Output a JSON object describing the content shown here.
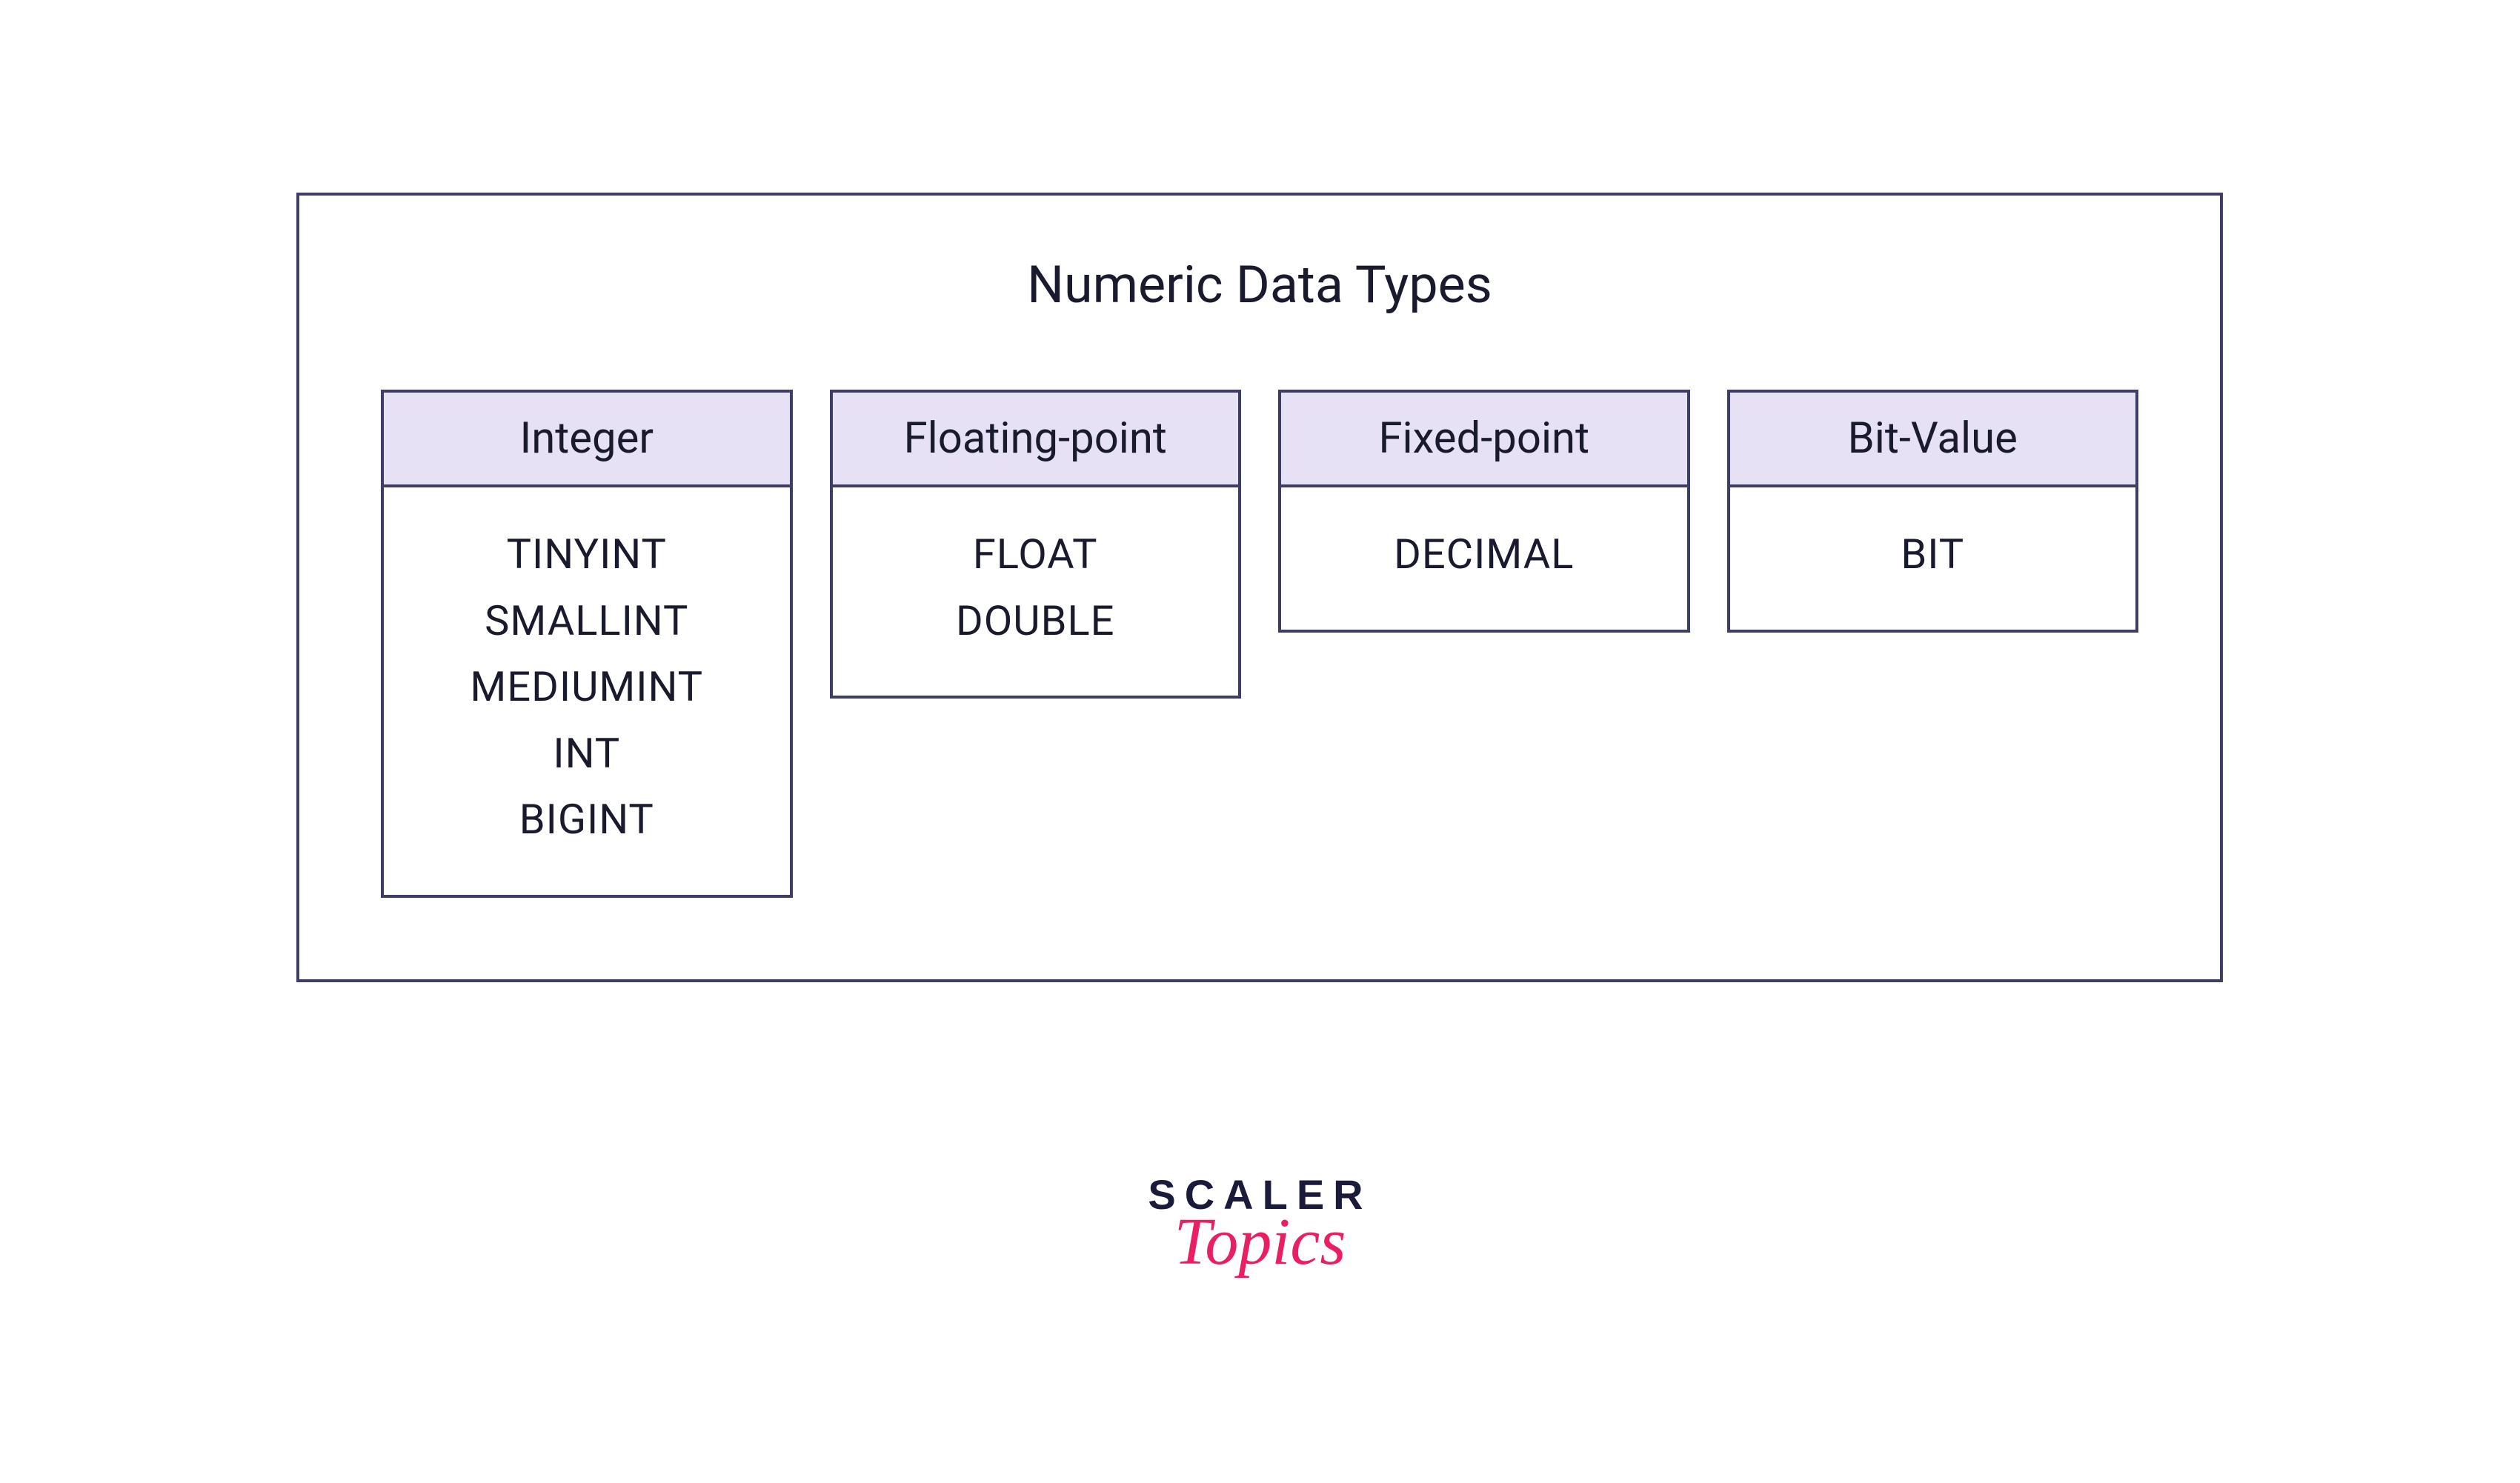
{
  "diagram": {
    "title": "Numeric Data Types",
    "categories": [
      {
        "header": "Integer",
        "items": [
          "TINYINT",
          "SMALLINT",
          "MEDIUMINT",
          "INT",
          "BIGINT"
        ]
      },
      {
        "header": "Floating-point",
        "items": [
          "FLOAT",
          "DOUBLE"
        ]
      },
      {
        "header": "Fixed-point",
        "items": [
          "DECIMAL"
        ]
      },
      {
        "header": "Bit-Value",
        "items": [
          "BIT"
        ]
      }
    ]
  },
  "logo": {
    "line1": "SCALER",
    "line2": "Topics"
  },
  "colors": {
    "border": "#3d3d66",
    "header_bg": "#e6e1f5",
    "logo_dark": "#1a1a3a",
    "logo_accent": "#e91e63"
  }
}
